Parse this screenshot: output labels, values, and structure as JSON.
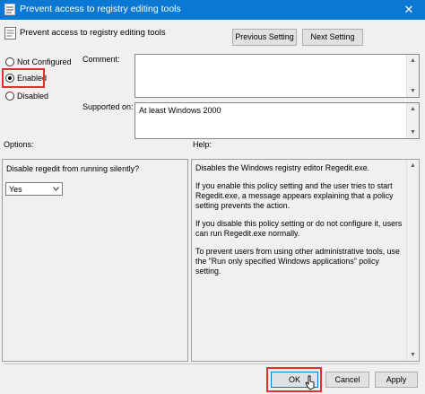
{
  "window": {
    "title": "Prevent access to registry editing tools",
    "close_glyph": "✕"
  },
  "header": {
    "policy_name": "Prevent access to registry editing tools",
    "previous_setting": "Previous Setting",
    "next_setting": "Next Setting"
  },
  "state": {
    "not_configured": "Not Configured",
    "enabled": "Enabled",
    "disabled": "Disabled",
    "selected": "Enabled"
  },
  "comment": {
    "label": "Comment:",
    "value": ""
  },
  "supported": {
    "label": "Supported on:",
    "value": "At least Windows 2000"
  },
  "options": {
    "label": "Options:",
    "prompt": "Disable regedit from running silently?",
    "selected_value": "Yes"
  },
  "help": {
    "label": "Help:",
    "paragraphs": [
      "Disables the Windows registry editor Regedit.exe.",
      "If you enable this policy setting and the user tries to start Regedit.exe, a message appears explaining that a policy setting prevents the action.",
      "If you disable this policy setting or do not configure it, users can run Regedit.exe normally.",
      "To prevent users from using other administrative tools, use the \"Run only specified Windows applications\" policy setting."
    ]
  },
  "footer": {
    "ok": "OK",
    "cancel": "Cancel",
    "apply": "Apply"
  },
  "colors": {
    "titlebar": "#0b78d4",
    "highlight": "#e03030",
    "dialog_bg": "#f0f0f0"
  },
  "icons": [
    "policy-icon",
    "close-icon",
    "cursor-icon"
  ]
}
